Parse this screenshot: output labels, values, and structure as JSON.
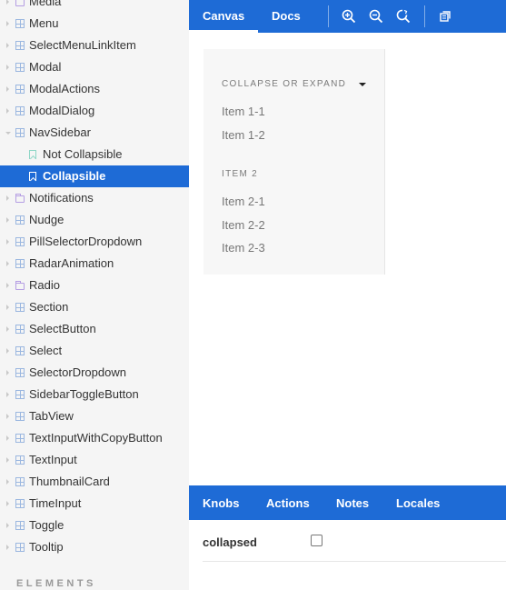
{
  "sidebar": {
    "items": [
      {
        "label": "Media",
        "icon": "folder-icon",
        "kind": "folder"
      },
      {
        "label": "Menu",
        "icon": "component-icon",
        "kind": "component"
      },
      {
        "label": "SelectMenuLinkItem",
        "icon": "component-icon",
        "kind": "component"
      },
      {
        "label": "Modal",
        "icon": "component-icon",
        "kind": "component"
      },
      {
        "label": "ModalActions",
        "icon": "component-icon",
        "kind": "component"
      },
      {
        "label": "ModalDialog",
        "icon": "component-icon",
        "kind": "component"
      },
      {
        "label": "NavSidebar",
        "icon": "component-icon",
        "kind": "component",
        "expanded": true
      },
      {
        "label": "Not Collapsible",
        "icon": "bookmark-icon",
        "kind": "story"
      },
      {
        "label": "Collapsible",
        "icon": "bookmark-icon",
        "kind": "story",
        "selected": true
      },
      {
        "label": "Notifications",
        "icon": "folder-icon",
        "kind": "folder"
      },
      {
        "label": "Nudge",
        "icon": "component-icon",
        "kind": "component"
      },
      {
        "label": "PillSelectorDropdown",
        "icon": "component-icon",
        "kind": "component"
      },
      {
        "label": "RadarAnimation",
        "icon": "component-icon",
        "kind": "component"
      },
      {
        "label": "Radio",
        "icon": "folder-icon",
        "kind": "folder"
      },
      {
        "label": "Section",
        "icon": "component-icon",
        "kind": "component"
      },
      {
        "label": "SelectButton",
        "icon": "component-icon",
        "kind": "component"
      },
      {
        "label": "Select",
        "icon": "component-icon",
        "kind": "component"
      },
      {
        "label": "SelectorDropdown",
        "icon": "component-icon",
        "kind": "component"
      },
      {
        "label": "SidebarToggleButton",
        "icon": "component-icon",
        "kind": "component"
      },
      {
        "label": "TabView",
        "icon": "component-icon",
        "kind": "component"
      },
      {
        "label": "TextInputWithCopyButton",
        "icon": "component-icon",
        "kind": "component"
      },
      {
        "label": "TextInput",
        "icon": "component-icon",
        "kind": "component"
      },
      {
        "label": "ThumbnailCard",
        "icon": "component-icon",
        "kind": "component"
      },
      {
        "label": "TimeInput",
        "icon": "component-icon",
        "kind": "component"
      },
      {
        "label": "Toggle",
        "icon": "component-icon",
        "kind": "component"
      },
      {
        "label": "Tooltip",
        "icon": "component-icon",
        "kind": "component"
      }
    ],
    "section_header": "ELEMENTS"
  },
  "toolbar": {
    "tabs": [
      {
        "label": "Canvas",
        "active": true
      },
      {
        "label": "Docs",
        "active": false
      }
    ],
    "icons": [
      "zoom-in-icon",
      "zoom-out-icon",
      "reset-zoom-icon",
      "copy-icon"
    ]
  },
  "preview": {
    "group1_label": "COLLAPSE OR EXPAND",
    "group1_items": [
      "Item 1-1",
      "Item 1-2"
    ],
    "group2_label": "ITEM 2",
    "group2_items": [
      "Item 2-1",
      "Item 2-2",
      "Item 2-3"
    ]
  },
  "addons": {
    "tabs": [
      "Knobs",
      "Actions",
      "Notes",
      "Locales"
    ],
    "knob": {
      "name": "collapsed",
      "checked": false
    }
  },
  "colors": {
    "accent": "#1e6bd6",
    "sidebar_bg": "#f5f5f5"
  }
}
